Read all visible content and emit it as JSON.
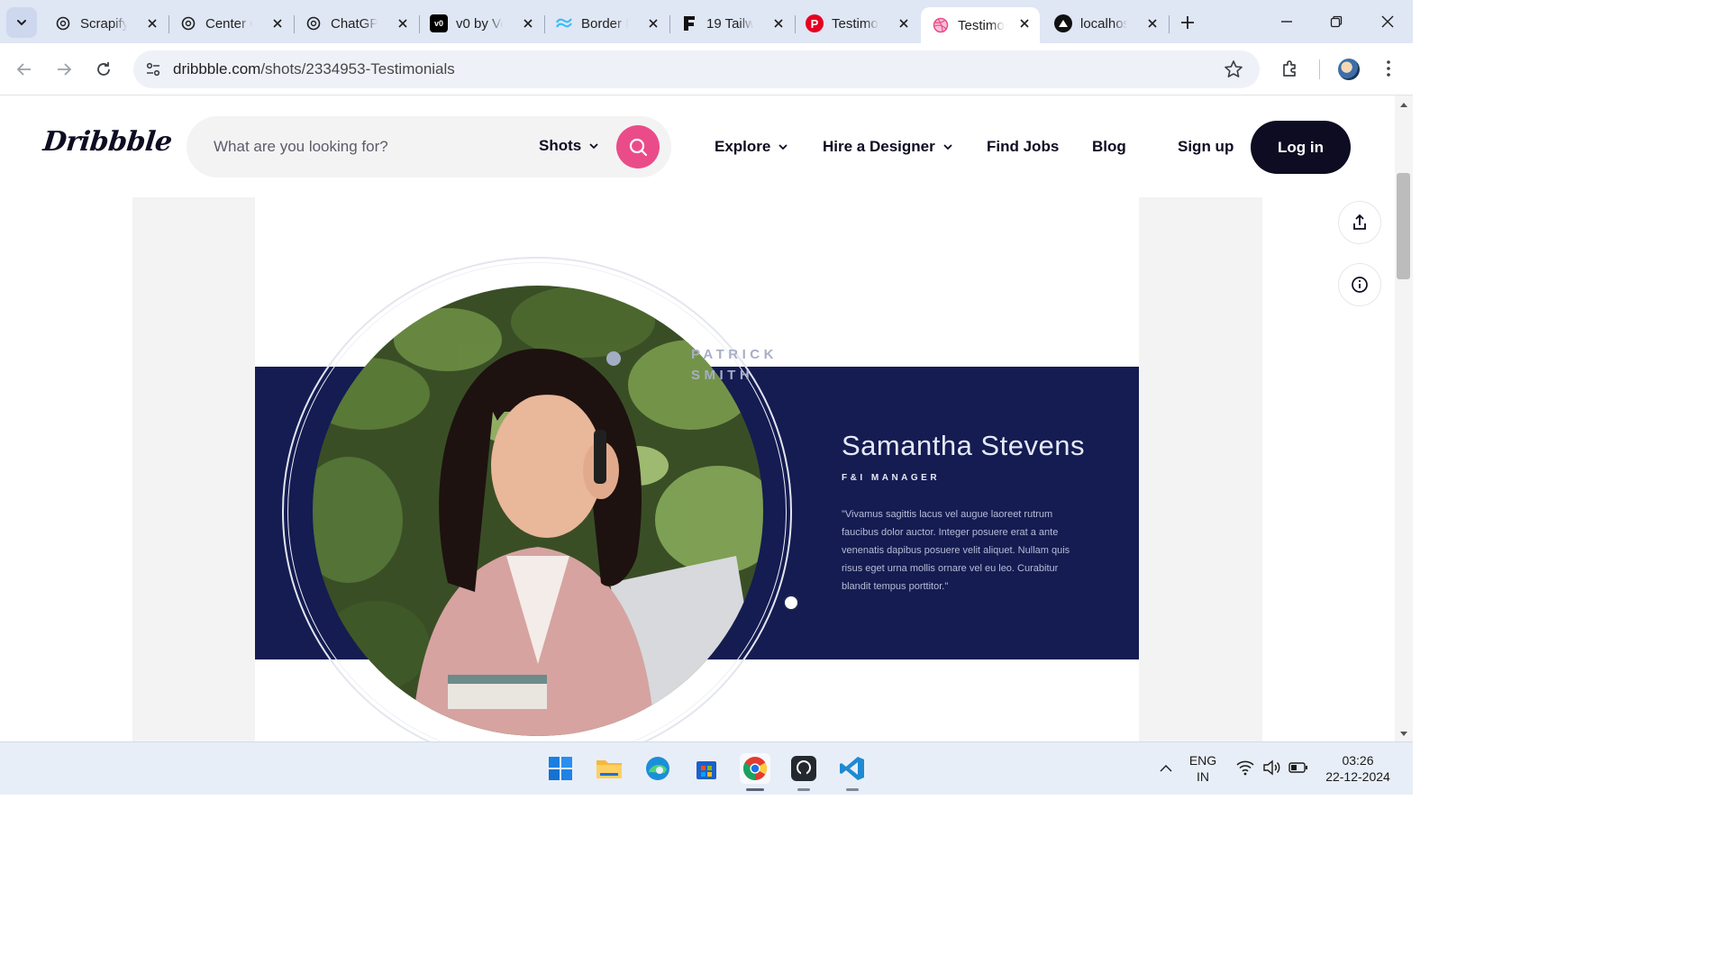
{
  "browser": {
    "tabs": [
      {
        "title": "Scrapify",
        "icon": "openai-icon",
        "active": false
      },
      {
        "title": "Center C",
        "icon": "openai-icon",
        "active": false
      },
      {
        "title": "ChatGPT",
        "icon": "openai-icon",
        "active": false
      },
      {
        "title": "v0 by Ve",
        "icon": "v0-icon",
        "active": false
      },
      {
        "title": "Border R",
        "icon": "tailwind-icon",
        "active": false
      },
      {
        "title": "19 Tailw",
        "icon": "flowbite-icon",
        "active": false
      },
      {
        "title": "Testimo",
        "icon": "pinterest-icon",
        "active": false
      },
      {
        "title": "Testimo",
        "icon": "dribbble-icon",
        "active": true
      },
      {
        "title": "localhos",
        "icon": "vercel-icon",
        "active": false
      }
    ],
    "url_host": "dribbble.com",
    "url_path": "/shots/2334953-Testimonials"
  },
  "header": {
    "logo": "Dribbble",
    "search_placeholder": "What are you looking for?",
    "search_scope": "Shots",
    "nav": {
      "explore": "Explore",
      "hire": "Hire a Designer",
      "jobs": "Find Jobs",
      "blog": "Blog"
    },
    "signup": "Sign up",
    "login": "Log in"
  },
  "shot": {
    "other_name_line1": "PATRICK",
    "other_name_line2": "SMITH",
    "name": "Samantha Stevens",
    "role": "F&I MANAGER",
    "quote": "\"Vivamus sagittis lacus vel augue laoreet rutrum faucibus dolor auctor. Integer posuere erat a ante venenatis dapibus posuere velit aliquet. Nullam quis risus eget urna mollis ornare vel eu leo. Curabitur blandit tempus porttitor.\"",
    "colors": {
      "band": "#141c52",
      "accent": "#ea4c89"
    }
  },
  "taskbar": {
    "lang_line1": "ENG",
    "lang_line2": "IN",
    "time": "03:26",
    "date": "22-12-2024"
  }
}
